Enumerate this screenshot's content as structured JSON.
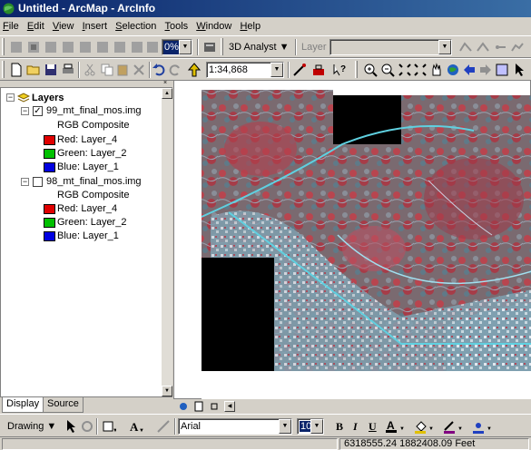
{
  "window": {
    "title": "Untitled - ArcMap - ArcInfo"
  },
  "menu": [
    "File",
    "Edit",
    "View",
    "Insert",
    "Selection",
    "Tools",
    "Window",
    "Help"
  ],
  "toolbar1": {
    "zoom_percent": "0%",
    "extension": "3D Analyst ▼",
    "layer_label": "Layer"
  },
  "toolbar2": {
    "scale": "1:34,868"
  },
  "toc": {
    "root": "Layers",
    "layers": [
      {
        "name": "99_mt_final_mos.img",
        "checked": true,
        "renderer": "RGB Composite",
        "bands": [
          {
            "label": "Red:",
            "value": "Layer_4",
            "color": "#e00000"
          },
          {
            "label": "Green:",
            "value": "Layer_2",
            "color": "#00c000"
          },
          {
            "label": "Blue:",
            "value": "Layer_1",
            "color": "#0000e0"
          }
        ]
      },
      {
        "name": "98_mt_final_mos.img",
        "checked": false,
        "renderer": "RGB Composite",
        "bands": [
          {
            "label": "Red:",
            "value": "Layer_4",
            "color": "#e00000"
          },
          {
            "label": "Green:",
            "value": "Layer_2",
            "color": "#00c000"
          },
          {
            "label": "Blue:",
            "value": "Layer_1",
            "color": "#0000e0"
          }
        ]
      }
    ]
  },
  "tabs": {
    "display": "Display",
    "source": "Source"
  },
  "drawing": {
    "label": "Drawing ▼",
    "font": "Arial",
    "size": "10",
    "bold": "B",
    "italic": "I",
    "underline": "U"
  },
  "status": {
    "coords": "6318555.24  1882408.09 Feet"
  }
}
